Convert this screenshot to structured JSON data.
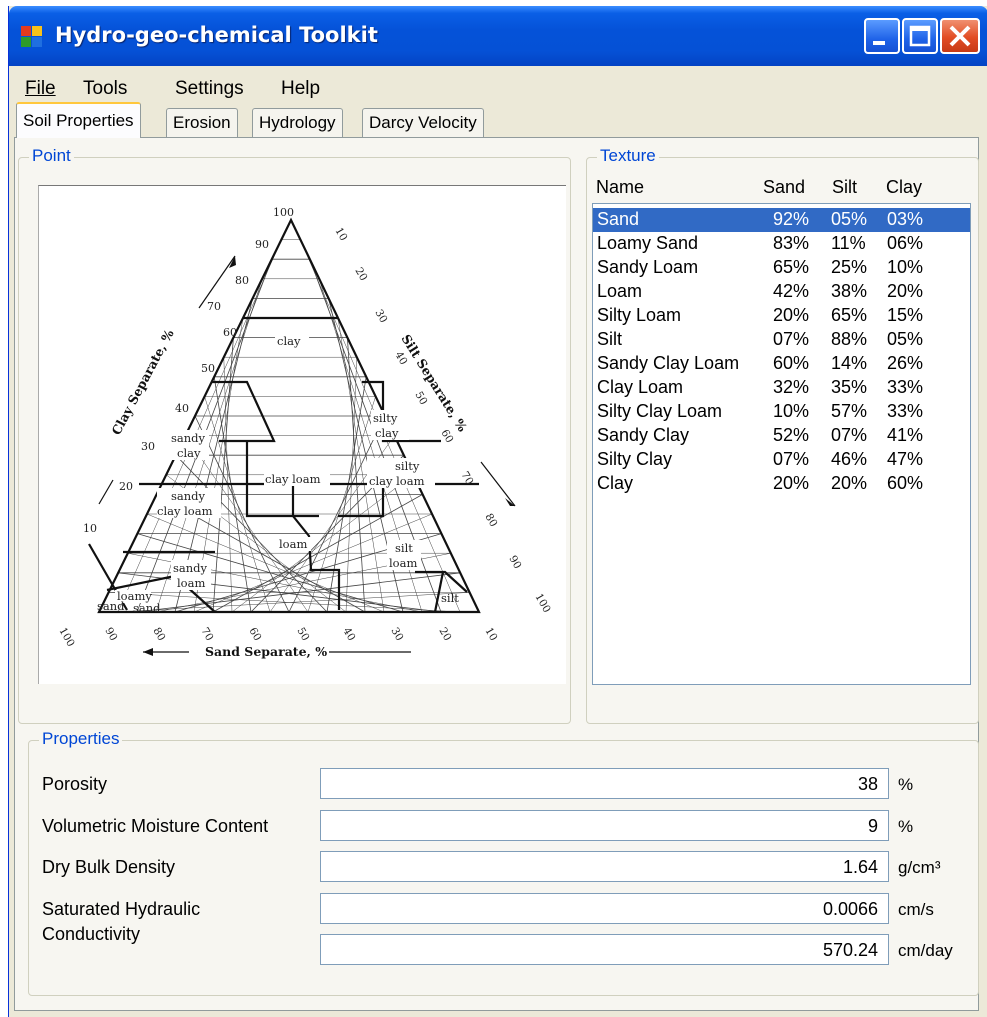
{
  "window": {
    "title": "Hydro-geo-chemical Toolkit"
  },
  "menu": {
    "file": "File",
    "tools": "Tools",
    "settings": "Settings",
    "help": "Help"
  },
  "tabs": [
    {
      "label": "Soil Properties",
      "selected": true
    },
    {
      "label": "Erosion"
    },
    {
      "label": "Hydrology"
    },
    {
      "label": "Darcy Velocity"
    }
  ],
  "point": {
    "title": "Point",
    "diagram": {
      "top_label": "100",
      "clay_axis_label": "Clay Separate, %",
      "silt_axis_label": "Silt Separate, %",
      "sand_axis_label": "Sand Separate, %",
      "left_ticks": [
        "90",
        "80",
        "70",
        "60",
        "50",
        "40",
        "30",
        "20",
        "10"
      ],
      "right_ticks": [
        "10",
        "20",
        "30",
        "40",
        "50",
        "60",
        "70",
        "80",
        "90",
        "100"
      ],
      "bottom_ticks": [
        "100",
        "90",
        "80",
        "70",
        "60",
        "50",
        "40",
        "30",
        "20",
        "10"
      ],
      "regions": {
        "clay": "clay",
        "silty_clay_1": "silty",
        "silty_clay_2": "clay",
        "sandy_clay_1": "sandy",
        "sandy_clay_2": "clay",
        "clay_loam": "clay loam",
        "silty_clay_loam_1": "silty",
        "silty_clay_loam_2": "clay loam",
        "sandy_clay_loam_1": "sandy",
        "sandy_clay_loam_2": "clay loam",
        "loam": "loam",
        "silt_loam_1": "silt",
        "silt_loam_2": "loam",
        "sandy_loam_1": "sandy",
        "sandy_loam_2": "loam",
        "loamy_sand_1": "loamy",
        "loamy_sand_2": "sand",
        "sand": "sand",
        "silt": "silt"
      }
    }
  },
  "texture": {
    "title": "Texture",
    "columns": {
      "name": "Name",
      "sand": "Sand",
      "silt": "Silt",
      "clay": "Clay"
    },
    "rows": [
      {
        "name": "Sand",
        "sand": "92%",
        "silt": "05%",
        "clay": "03%"
      },
      {
        "name": "Loamy Sand",
        "sand": "83%",
        "silt": "11%",
        "clay": "06%"
      },
      {
        "name": "Sandy Loam",
        "sand": "65%",
        "silt": "25%",
        "clay": "10%"
      },
      {
        "name": "Loam",
        "sand": "42%",
        "silt": "38%",
        "clay": "20%"
      },
      {
        "name": "Silty Loam",
        "sand": "20%",
        "silt": "65%",
        "clay": "15%"
      },
      {
        "name": "Silt",
        "sand": "07%",
        "silt": "88%",
        "clay": "05%"
      },
      {
        "name": "Sandy Clay Loam",
        "sand": "60%",
        "silt": "14%",
        "clay": "26%"
      },
      {
        "name": "Clay Loam",
        "sand": "32%",
        "silt": "35%",
        "clay": "33%"
      },
      {
        "name": "Silty Clay Loam",
        "sand": "10%",
        "silt": "57%",
        "clay": "33%"
      },
      {
        "name": "Sandy Clay",
        "sand": "52%",
        "silt": "07%",
        "clay": "41%"
      },
      {
        "name": "Silty Clay",
        "sand": "07%",
        "silt": "46%",
        "clay": "47%"
      },
      {
        "name": "Clay",
        "sand": "20%",
        "silt": "20%",
        "clay": "60%"
      }
    ],
    "selected_row": "Sand"
  },
  "properties": {
    "title": "Properties",
    "porosity": {
      "label": "Porosity",
      "value": "38",
      "unit": "%"
    },
    "moisture": {
      "label": "Volumetric Moisture Content",
      "value": "9",
      "unit": "%"
    },
    "density": {
      "label": "Dry Bulk Density",
      "value": "1.64",
      "unit": "g/cm³"
    },
    "conductivity": {
      "label_line1": "Saturated Hydraulic",
      "label_line2": "Conductivity",
      "value_cms": "0.0066",
      "unit_cms": "cm/s",
      "value_cmday": "570.24",
      "unit_cmday": "cm/day"
    }
  },
  "colors": {
    "accent": "#0046d5",
    "selection": "#316ac5",
    "titlebar": "#0552d8"
  }
}
